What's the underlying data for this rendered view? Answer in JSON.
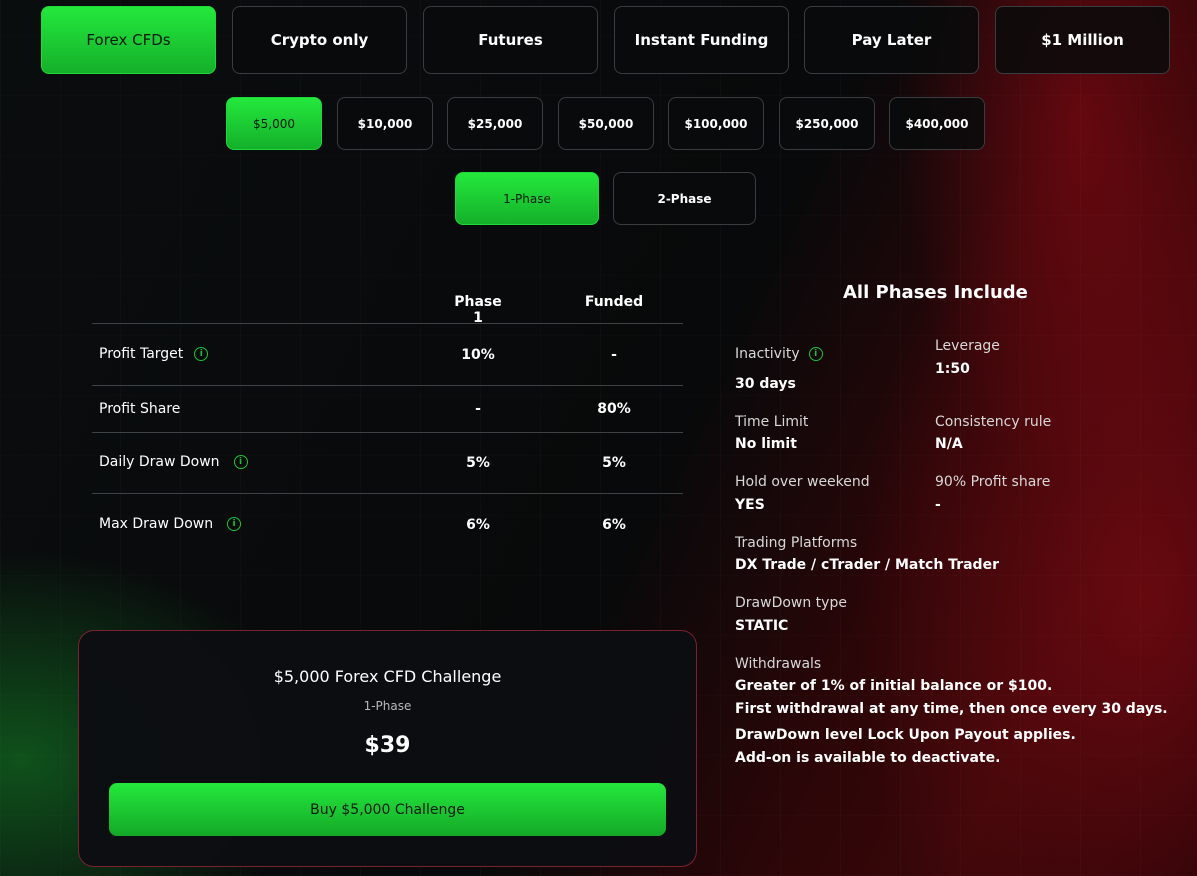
{
  "categories": [
    {
      "label": "Forex CFDs",
      "active": true
    },
    {
      "label": "Crypto only",
      "active": false
    },
    {
      "label": "Futures",
      "active": false
    },
    {
      "label": "Instant Funding",
      "active": false
    },
    {
      "label": "Pay Later",
      "active": false
    },
    {
      "label": "$1 Million",
      "active": false
    }
  ],
  "amounts": [
    {
      "label": "$5,000",
      "active": true
    },
    {
      "label": "$10,000",
      "active": false
    },
    {
      "label": "$25,000",
      "active": false
    },
    {
      "label": "$50,000",
      "active": false
    },
    {
      "label": "$100,000",
      "active": false
    },
    {
      "label": "$250,000",
      "active": false
    },
    {
      "label": "$400,000",
      "active": false
    }
  ],
  "phases": [
    {
      "label": "1-Phase",
      "active": true
    },
    {
      "label": "2-Phase",
      "active": false
    }
  ],
  "table": {
    "headers": [
      "Phase 1",
      "Funded"
    ],
    "rows": [
      {
        "label": "Profit Target",
        "info": true,
        "phase1": "10%",
        "funded": "-"
      },
      {
        "label": "Profit Share",
        "info": false,
        "phase1": "-",
        "funded": "80%"
      },
      {
        "label": "Daily Draw Down",
        "info": true,
        "phase1": "5%",
        "funded": "5%"
      },
      {
        "label": "Max Draw Down",
        "info": true,
        "phase1": "6%",
        "funded": "6%"
      }
    ]
  },
  "phases_include": {
    "title": "All Phases Include",
    "inactivity": {
      "label": "Inactivity",
      "value": "30 days"
    },
    "leverage": {
      "label": "Leverage",
      "value": "1:50"
    },
    "time_limit": {
      "label": "Time Limit",
      "value": "No limit"
    },
    "consistency": {
      "label": "Consistency rule",
      "value": "N/A"
    },
    "weekend": {
      "label": "Hold over weekend",
      "value": "YES"
    },
    "profit_share": {
      "label": "90% Profit share",
      "value": "-"
    },
    "platforms": {
      "label": "Trading Platforms",
      "value": "DX Trade / cTrader / Match Trader"
    },
    "drawdown_type": {
      "label": "DrawDown type",
      "value": "STATIC"
    },
    "withdrawals": {
      "label": "Withdrawals",
      "lines": [
        "Greater of 1% of initial balance or $100.",
        "First withdrawal at any time, then once every 30 days.",
        "DrawDown level Lock Upon Payout applies.",
        "Add-on is available to deactivate."
      ]
    }
  },
  "challenge_card": {
    "title": "$5,000 Forex CFD Challenge",
    "subtitle": "1-Phase",
    "price": "$39",
    "buy_label": "Buy $5,000 Challenge"
  },
  "colors": {
    "accent_green": "#1fd83a",
    "card_border": "#7a2230",
    "info_green": "#1ec23a"
  }
}
